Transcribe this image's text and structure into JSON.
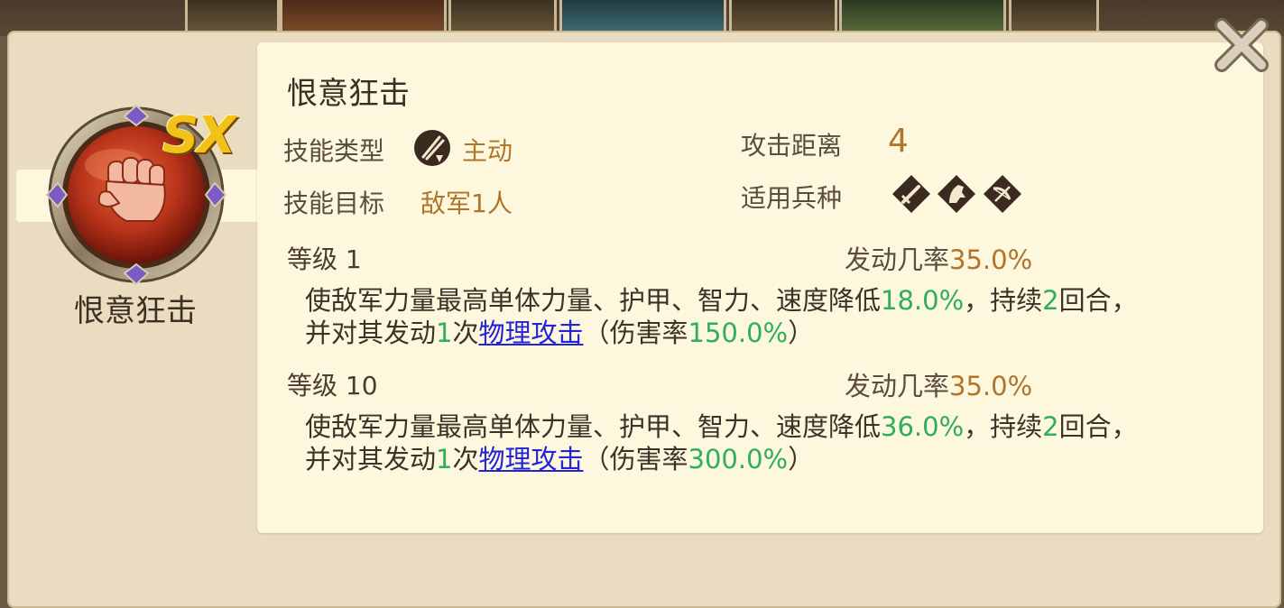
{
  "skill": {
    "name": "恨意狂击",
    "badge": "SX",
    "labels": {
      "type": "技能类型",
      "target": "技能目标",
      "range": "攻击距离",
      "troops": "适用兵种"
    },
    "type_value": "主动",
    "target_value": "敌军1人",
    "range_value": "4",
    "type_icon": "crossed-swords-icon",
    "troop_icons": [
      "infantry-sword-icon",
      "cavalry-horse-icon",
      "archer-bow-icon"
    ]
  },
  "levels": [
    {
      "label": "等级 1",
      "rate_label": "发动几率",
      "rate_value": "35.0%",
      "line1": {
        "a": "使敌军力量最高单体力量、护甲、智力、速度降低",
        "b": "18.0%",
        "c": "，持续",
        "d": "2",
        "e": "回合，"
      },
      "line2": {
        "a": "并对其发动",
        "b": "1",
        "c": "次",
        "link": "物理攻击",
        "d": "（伤害率",
        "e": "150.0%",
        "f": "）"
      }
    },
    {
      "label": "等级 10",
      "rate_label": "发动几率",
      "rate_value": "35.0%",
      "line1": {
        "a": "使敌军力量最高单体力量、护甲、智力、速度降低",
        "b": "36.0%",
        "c": "，持续",
        "d": "2",
        "e": "回合，"
      },
      "line2": {
        "a": "并对其发动",
        "b": "1",
        "c": "次",
        "link": "物理攻击",
        "d": "（伤害率",
        "e": "300.0%",
        "f": "）"
      }
    }
  ],
  "colors": {
    "accent_orange": "#b0742a",
    "value_green": "#2fae5b",
    "link_blue": "#2323d8",
    "panel_bg": "#fdf7dd",
    "frame_bg": "#e9dcc0"
  }
}
